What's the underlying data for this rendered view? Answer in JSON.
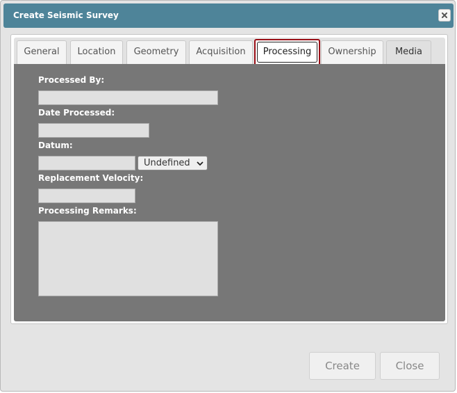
{
  "dialog": {
    "title": "Create Seismic Survey"
  },
  "tabs": [
    {
      "label": "General"
    },
    {
      "label": "Location"
    },
    {
      "label": "Geometry"
    },
    {
      "label": "Acquisition"
    },
    {
      "label": "Processing",
      "active": true
    },
    {
      "label": "Ownership"
    },
    {
      "label": "Media"
    }
  ],
  "form": {
    "processed_by_label": "Processed By:",
    "processed_by_value": "",
    "date_processed_label": "Date Processed:",
    "date_processed_value": "",
    "datum_label": "Datum:",
    "datum_value": "",
    "datum_unit": "Undefined",
    "replacement_velocity_label": "Replacement Velocity:",
    "replacement_velocity_value": "",
    "processing_remarks_label": "Processing Remarks:",
    "processing_remarks_value": ""
  },
  "buttons": {
    "create": "Create",
    "close": "Close"
  },
  "colors": {
    "titlebar": "#4e8499",
    "panel": "#777777",
    "active_tab_outline": "#9a0e16"
  },
  "icons": {
    "close": "close-icon",
    "dropdown": "chevron-down-icon"
  }
}
